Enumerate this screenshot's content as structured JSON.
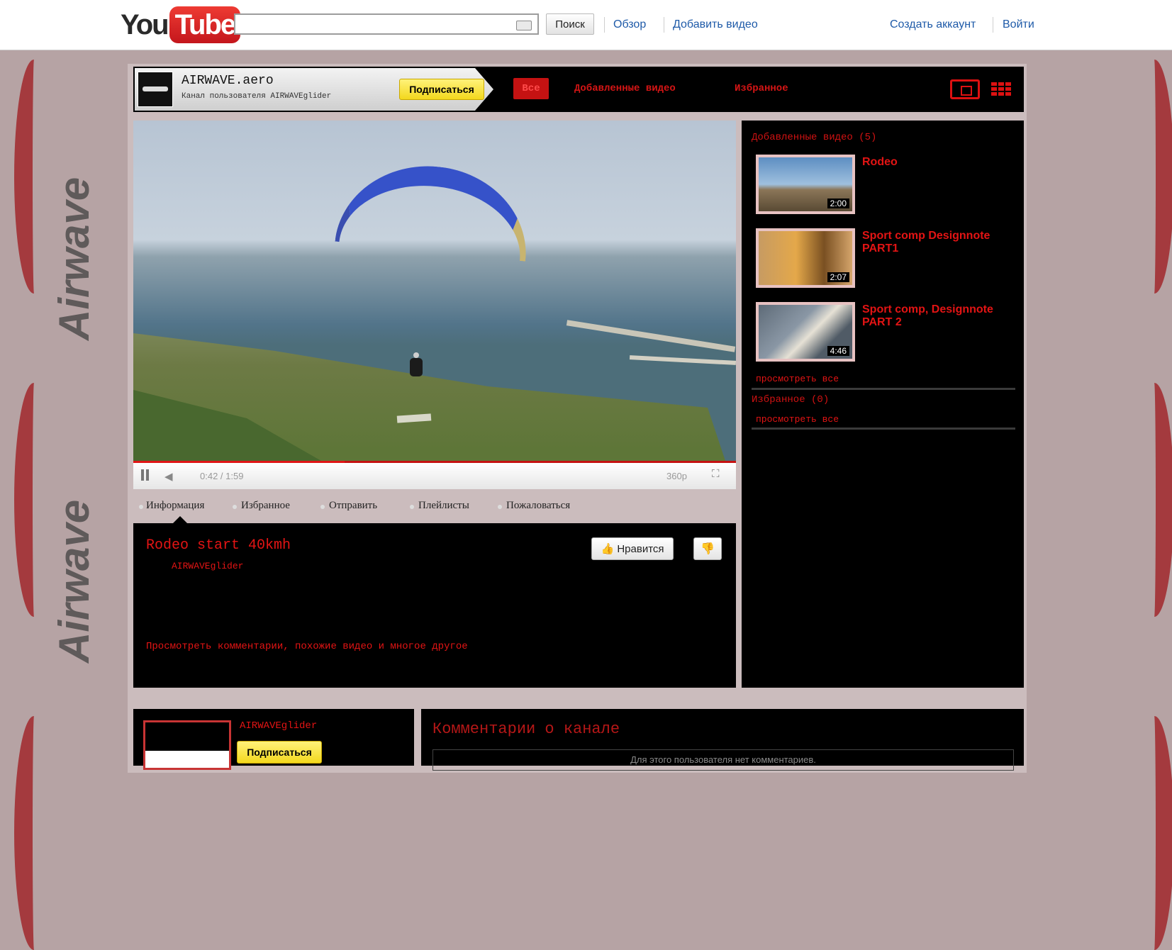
{
  "header": {
    "logo_you": "You",
    "logo_tube": "Tube",
    "search_placeholder": "",
    "search_button": "Поиск",
    "nav": [
      "Обзор",
      "Добавить видео"
    ],
    "account": [
      "Создать аккаунт",
      "Войти"
    ]
  },
  "decor": {
    "brand_text": "Airwave"
  },
  "channel": {
    "name": "AIRWAVE.aero",
    "subtitle": "Канал пользователя AIRWAVEglider",
    "subscribe": "Подписаться",
    "tabs": [
      "Все",
      "Добавленные видео",
      "Избранное"
    ]
  },
  "player": {
    "time": "0:42 / 1:59",
    "quality": "360p",
    "progress_fraction": 0.35
  },
  "video_tabs": [
    "Информация",
    "Избранное",
    "Отправить",
    "Плейлисты",
    "Пожаловаться"
  ],
  "video": {
    "title": "Rodeo start 40kmh",
    "author": "AIRWAVEglider",
    "like": "Нравится",
    "more": "Просмотреть комментарии, похожие видео и многое другое"
  },
  "sidebar": {
    "uploads_heading": "Добавленные видео (5)",
    "items": [
      {
        "title": "Rodeo",
        "duration": "2:00"
      },
      {
        "title": "Sport comp Designnote PART1",
        "duration": "2:07"
      },
      {
        "title": "Sport comp, Designnote PART 2",
        "duration": "4:46"
      }
    ],
    "view_all": "просмотреть все",
    "favorites_heading": "Избранное (0)",
    "view_all_fav": "просмотреть все"
  },
  "profile": {
    "name": "AIRWAVEglider",
    "subscribe": "Подписаться"
  },
  "comments": {
    "title": "Комментарии о канале",
    "empty": "Для этого пользователя нет комментариев."
  },
  "colors": {
    "accent": "#e31414",
    "panel": "#000000",
    "background": "#b6a3a4",
    "link": "#1e5aa8",
    "subscribe": "#f3d81d"
  }
}
